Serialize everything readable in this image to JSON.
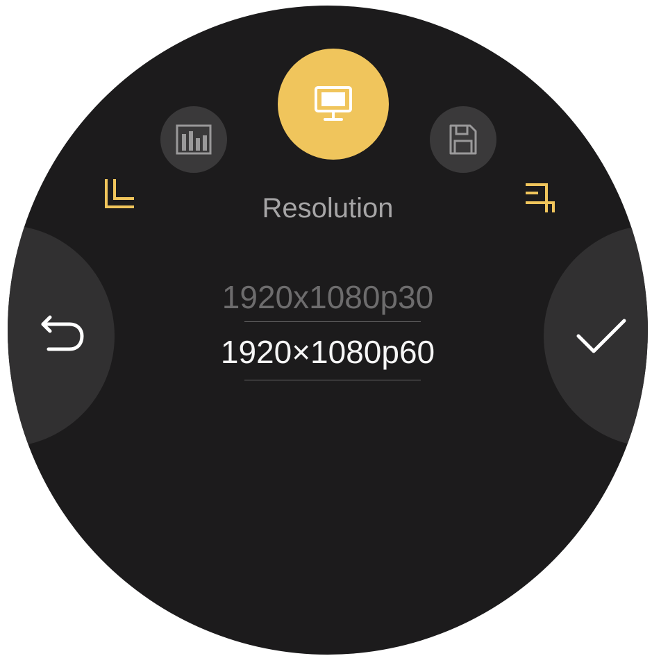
{
  "screen": {
    "title": "Resolution",
    "options": {
      "previous": "1920x1080p30",
      "current": "1920×1080p60"
    }
  },
  "tabs": [
    {
      "icon": "bar-chart-icon",
      "active": false
    },
    {
      "icon": "monitor-icon",
      "active": true
    },
    {
      "icon": "save-icon",
      "active": false
    }
  ],
  "actions": {
    "back_icon": "undo-arrow-icon",
    "confirm_icon": "checkmark-icon"
  },
  "colors": {
    "background": "#1c1b1c",
    "accent": "#f0c55c",
    "inactive_tab": "#3a393a",
    "side_button": "#313031",
    "title_text": "#a6a5a6",
    "selected_text": "#f6f6f6",
    "unselected_text": "#6d6c6d"
  }
}
